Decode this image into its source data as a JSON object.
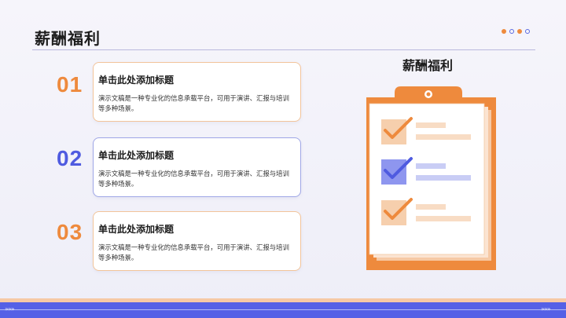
{
  "header": {
    "title": "薪酬福利"
  },
  "items": [
    {
      "number": "01",
      "title": "单击此处添加标题",
      "desc": "演示文稿是一种专业化的信息承载平台，可用于演讲、汇报与培训等多种场景。"
    },
    {
      "number": "02",
      "title": "单击此处添加标题",
      "desc": "演示文稿是一种专业化的信息承载平台，可用于演讲、汇报与培训等多种场景。"
    },
    {
      "number": "03",
      "title": "单击此处添加标题",
      "desc": "演示文稿是一种专业化的信息承载平台，可用于演讲、汇报与培训等多种场景。"
    }
  ],
  "illustration": {
    "title": "薪酬福利",
    "icon": "clipboard-checklist-icon"
  },
  "colors": {
    "orange": "#ee8a3d",
    "blue": "#4f5be0",
    "light_orange": "#f6cfad",
    "light_blue": "#c9cdf5"
  },
  "footer": {
    "chevrons_left": "»»»",
    "chevrons_right": "»»»"
  }
}
